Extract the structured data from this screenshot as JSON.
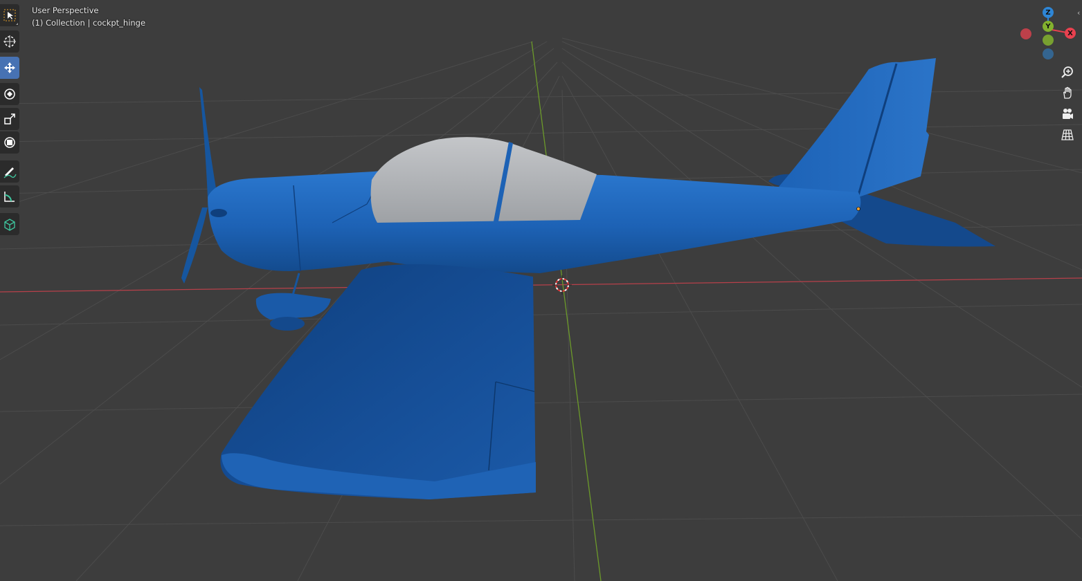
{
  "viewport": {
    "view_name": "User Perspective",
    "collection_line": "(1) Collection | cockpt_hinge",
    "background_color": "#3d3d3d",
    "grid_color": "#4c4c4c",
    "x_axis_color": "#b8404a",
    "y_axis_color": "#6c9a2a"
  },
  "toolbar": {
    "tools": [
      {
        "name": "select-box-tool",
        "icon": "select-box-icon",
        "active": false
      },
      {
        "name": "cursor-tool",
        "icon": "cursor-icon",
        "active": false
      },
      {
        "name": "move-tool",
        "icon": "move-icon",
        "active": true
      },
      {
        "name": "rotate-tool",
        "icon": "rotate-icon",
        "active": false
      },
      {
        "name": "scale-tool",
        "icon": "scale-icon",
        "active": false
      },
      {
        "name": "transform-tool",
        "icon": "transform-icon",
        "active": false
      },
      {
        "name": "annotate-tool",
        "icon": "annotate-icon",
        "active": false
      },
      {
        "name": "measure-tool",
        "icon": "measure-icon",
        "active": false
      },
      {
        "name": "add-cube-tool",
        "icon": "add-cube-icon",
        "active": false
      }
    ]
  },
  "gizmo": {
    "x_label": "X",
    "y_label": "Y",
    "z_label": "Z",
    "x_color": "#e8414f",
    "y_color": "#83b22e",
    "z_color": "#2e86d6"
  },
  "navigation": [
    {
      "name": "zoom-button",
      "icon": "zoom-icon"
    },
    {
      "name": "pan-button",
      "icon": "hand-icon"
    },
    {
      "name": "camera-view-button",
      "icon": "camera-icon"
    },
    {
      "name": "perspective-toggle-button",
      "icon": "grid-icon"
    }
  ],
  "model": {
    "object": "airplane",
    "body_color": "#1e64b8",
    "canopy_color": "#b4b6b9"
  }
}
